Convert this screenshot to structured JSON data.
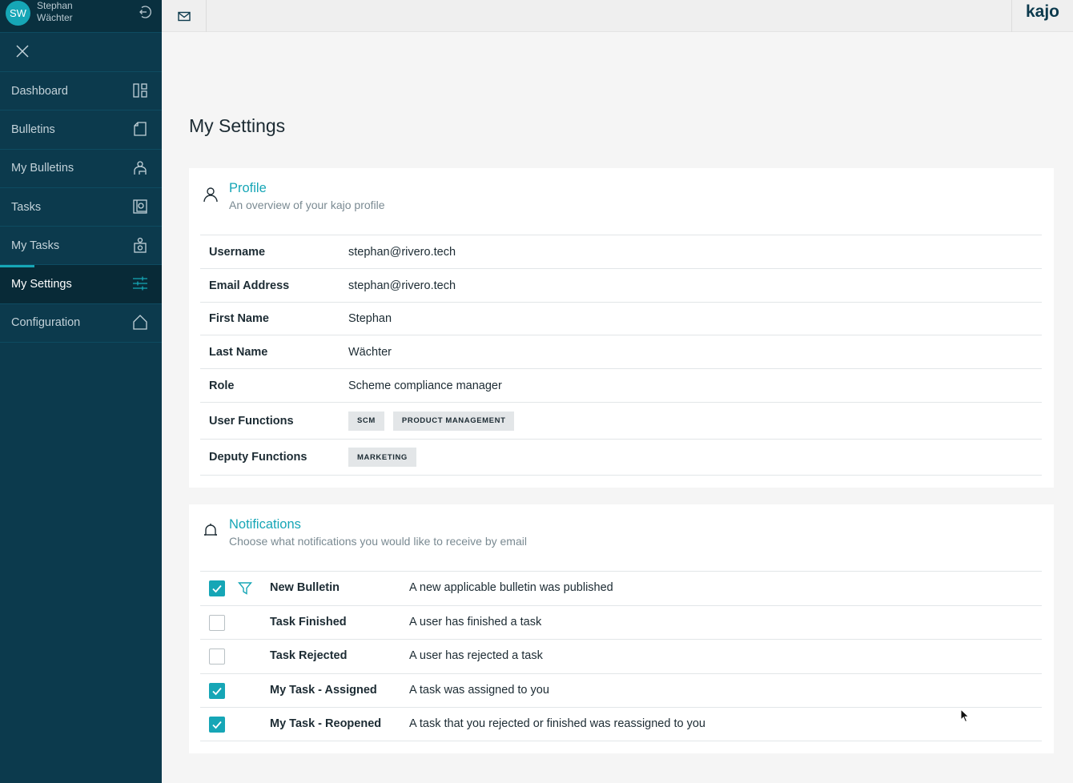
{
  "user": {
    "initials": "SW",
    "first_name": "Stephan",
    "last_name": "Wächter"
  },
  "topbar": {
    "brand": "kajo"
  },
  "sidebar": {
    "items": [
      {
        "label": "Dashboard",
        "icon": "dashboard-icon"
      },
      {
        "label": "Bulletins",
        "icon": "bulletin-icon"
      },
      {
        "label": "My Bulletins",
        "icon": "my-bulletins-icon"
      },
      {
        "label": "Tasks",
        "icon": "tasks-icon"
      },
      {
        "label": "My Tasks",
        "icon": "my-tasks-icon"
      },
      {
        "label": "My Settings",
        "icon": "settings-sliders-icon",
        "active": true
      },
      {
        "label": "Configuration",
        "icon": "home-icon"
      }
    ]
  },
  "page": {
    "title": "My Settings"
  },
  "profile": {
    "title": "Profile",
    "subtitle": "An overview of your kajo profile",
    "rows": [
      {
        "label": "Username",
        "value": "stephan@rivero.tech"
      },
      {
        "label": "Email Address",
        "value": "stephan@rivero.tech"
      },
      {
        "label": "First Name",
        "value": "Stephan"
      },
      {
        "label": "Last Name",
        "value": "Wächter"
      },
      {
        "label": "Role",
        "value": "Scheme compliance manager"
      },
      {
        "label": "User Functions",
        "tags": [
          "SCM",
          "PRODUCT MANAGEMENT"
        ]
      },
      {
        "label": "Deputy Functions",
        "tags": [
          "MARKETING"
        ]
      }
    ]
  },
  "notifications": {
    "title": "Notifications",
    "subtitle": "Choose what notifications you would like to receive by email",
    "rows": [
      {
        "name": "New Bulletin",
        "description": "A new applicable bulletin was published",
        "checked": true,
        "has_filter": true
      },
      {
        "name": "Task Finished",
        "description": "A user has finished a task",
        "checked": false
      },
      {
        "name": "Task Rejected",
        "description": "A user has rejected a task",
        "checked": false
      },
      {
        "name": "My Task - Assigned",
        "description": "A task was assigned to you",
        "checked": true
      },
      {
        "name": "My Task - Reopened",
        "description": "A task that you rejected or finished was reassigned to you",
        "checked": true
      }
    ]
  },
  "colors": {
    "sidebar": "#0c3a4d",
    "accent": "#16a6b6",
    "active_nav": "#082a37"
  }
}
